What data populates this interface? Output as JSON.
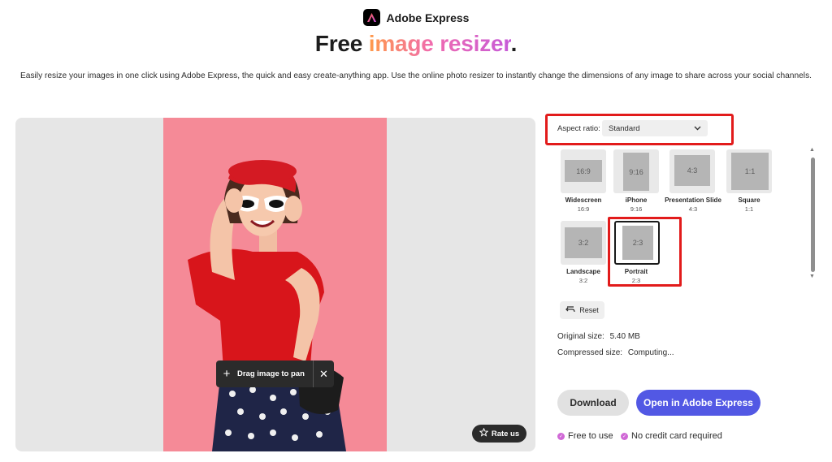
{
  "header": {
    "brand_name": "Adobe Express",
    "title_plain": "Free ",
    "title_highlight": "image resizer",
    "title_end": ".",
    "subtitle": "Easily resize your images in one click using Adobe Express, the quick and easy create-anything app. Use the online photo resizer to instantly change the dimensions of any image to share across your social channels."
  },
  "preview": {
    "drag_label": "Drag image to pan",
    "drag_close": "✕",
    "rate_label": "Rate us"
  },
  "panel": {
    "aspect_label": "Aspect ratio:",
    "aspect_value": "Standard",
    "presets": [
      {
        "ratio": "16:9",
        "name": "Widescreen",
        "sub": "16:9"
      },
      {
        "ratio": "9:16",
        "name": "iPhone",
        "sub": "9:16"
      },
      {
        "ratio": "4:3",
        "name": "Presentation Slide",
        "sub": "4:3"
      },
      {
        "ratio": "1:1",
        "name": "Square",
        "sub": "1:1"
      },
      {
        "ratio": "3:2",
        "name": "Landscape",
        "sub": "3:2"
      },
      {
        "ratio": "2:3",
        "name": "Portrait",
        "sub": "2:3"
      }
    ],
    "selected_preset": "Portrait",
    "reset_label": "Reset",
    "original_size_label": "Original size:",
    "original_size_value": "5.40 MB",
    "compressed_size_label": "Compressed size:",
    "compressed_size_value": "Computing...",
    "download_label": "Download",
    "open_label": "Open in Adobe Express",
    "perks": [
      "Free to use",
      "No credit card required"
    ]
  },
  "colors": {
    "accent": "#5258e4",
    "highlight_box": "#e21b1b",
    "photo_bg": "#f58a97",
    "perk_check": "#d068d6"
  }
}
